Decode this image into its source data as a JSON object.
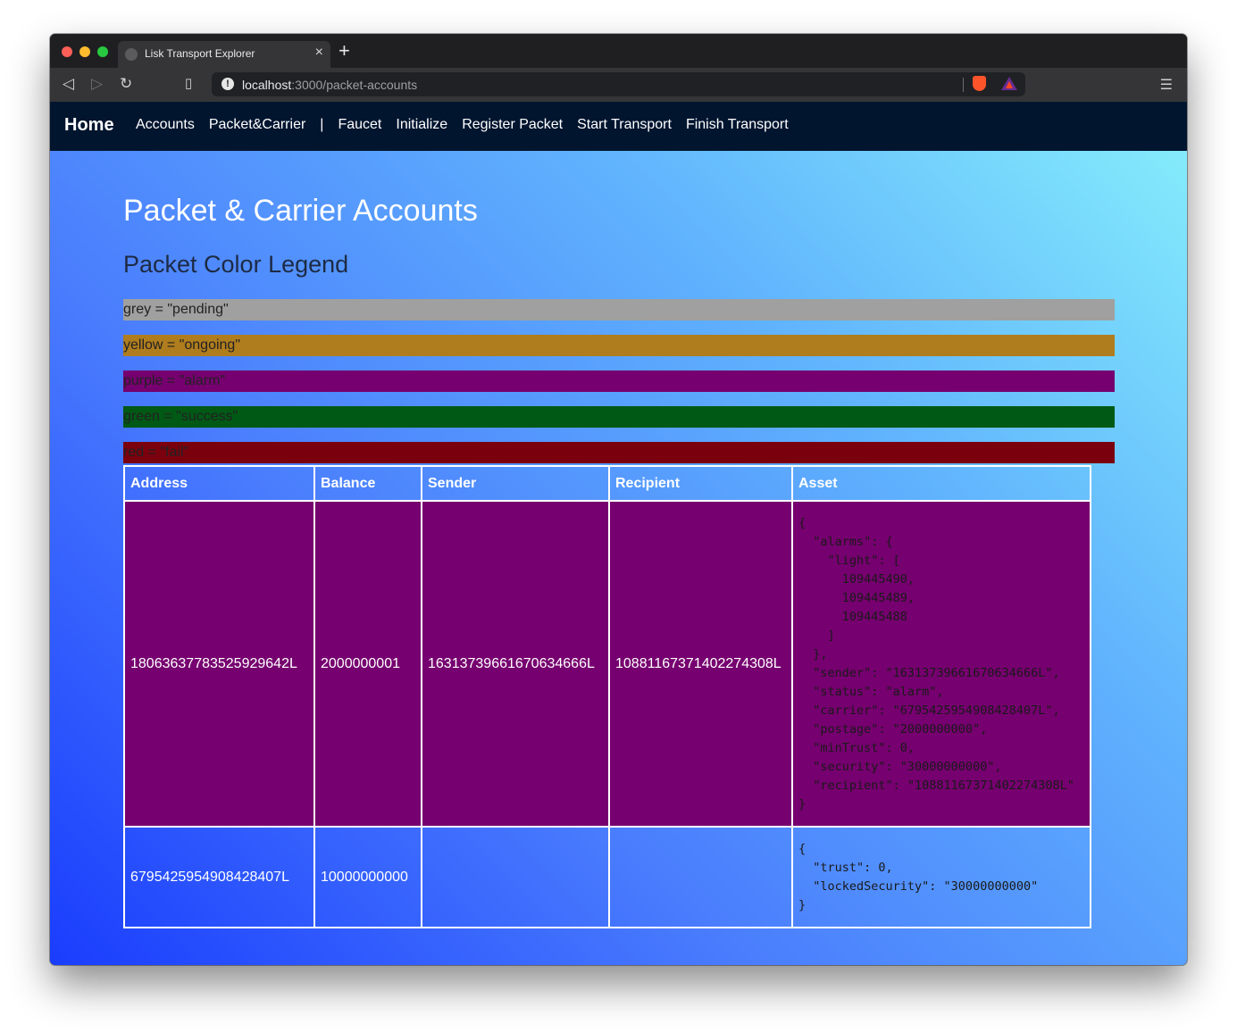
{
  "browser": {
    "tab_title": "Lisk Transport Explorer",
    "url_host": "localhost",
    "url_rest": ":3000/packet-accounts"
  },
  "navbar": {
    "brand": "Home",
    "links": [
      "Accounts",
      "Packet&Carrier",
      "|",
      "Faucet",
      "Initialize",
      "Register Packet",
      "Start Transport",
      "Finish Transport"
    ]
  },
  "page": {
    "title": "Packet & Carrier Accounts",
    "legend_title": "Packet Color Legend",
    "legend": [
      {
        "text": "grey = \"pending\"",
        "color": "#a0a0a0"
      },
      {
        "text": "yellow = \"ongoing\"",
        "color": "#b07d1e"
      },
      {
        "text": "purple = \"alarm\"",
        "color": "#76006f"
      },
      {
        "text": "green = \"success\"",
        "color": "#005915"
      },
      {
        "text": "red = \"fail\"",
        "color": "#7b000e"
      }
    ]
  },
  "table": {
    "headers": [
      "Address",
      "Balance",
      "Sender",
      "Recipient",
      "Asset"
    ],
    "rows": [
      {
        "address": "18063637783525929642L",
        "balance": "2000000001",
        "sender": "16313739661670634666L",
        "recipient": "10881167371402274308L",
        "asset": "{\n  \"alarms\": {\n    \"light\": [\n      109445490,\n      109445489,\n      109445488\n    ]\n  },\n  \"sender\": \"16313739661670634666L\",\n  \"status\": \"alarm\",\n  \"carrier\": \"6795425954908428407L\",\n  \"postage\": \"2000000000\",\n  \"minTrust\": 0,\n  \"security\": \"30000000000\",\n  \"recipient\": \"10881167371402274308L\"\n}",
        "status_color": "#76006f"
      },
      {
        "address": "6795425954908428407L",
        "balance": "10000000000",
        "sender": "",
        "recipient": "",
        "asset": "{\n  \"trust\": 0,\n  \"lockedSecurity\": \"30000000000\"\n}",
        "status_color": ""
      }
    ]
  }
}
